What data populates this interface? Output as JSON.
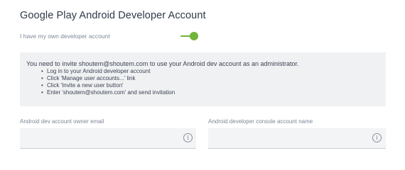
{
  "section": {
    "title": "Google Play Android Developer Account"
  },
  "toggle": {
    "label": "I have my own developer account",
    "state": "on",
    "color": "#71b43c"
  },
  "info": {
    "message": "You need to invite shoutem@shoutem.com to use your Android dev account as an administrator.",
    "steps": [
      "Log in to your Android developer account",
      "Click 'Manage user accounts...' link",
      "Click 'Invite a new user button'",
      "Enter 'shoutem@shoutem.com' and send invitation"
    ]
  },
  "fields": {
    "owner_email": {
      "label": "Android dev account owner email",
      "value": "",
      "icon": "info-icon"
    },
    "console_name": {
      "label": "Android developer console account name",
      "value": "",
      "icon": "info-icon"
    }
  }
}
